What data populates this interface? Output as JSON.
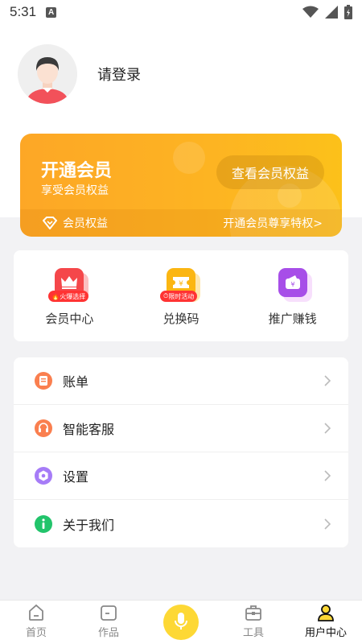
{
  "status": {
    "time": "5:31",
    "notif_letter": "A"
  },
  "profile": {
    "login_label": "请登录"
  },
  "vip": {
    "title": "开通会员",
    "subtitle": "享受会员权益",
    "button": "查看会员权益",
    "rights_label": "会员权益",
    "privilege_link": "开通会员尊享特权>"
  },
  "quick": [
    {
      "label": "会员中心",
      "badge": "火爆选择",
      "icon": "crown-icon",
      "color": "#f5474a"
    },
    {
      "label": "兑换码",
      "badge": "限时活动",
      "icon": "coupon-icon",
      "color": "#fbb612"
    },
    {
      "label": "推广赚钱",
      "badge": "",
      "icon": "wallet-icon",
      "color": "#a74ee8"
    }
  ],
  "menu": [
    {
      "label": "账单",
      "icon": "bill-icon",
      "color": "#fa7f4f"
    },
    {
      "label": "智能客服",
      "icon": "headset-icon",
      "color": "#fa7f4f"
    },
    {
      "label": "设置",
      "icon": "settings-icon",
      "color": "#a67cf7"
    },
    {
      "label": "关于我们",
      "icon": "info-icon",
      "color": "#22c46b"
    }
  ],
  "tabs": [
    {
      "label": "首页",
      "icon": "home-icon"
    },
    {
      "label": "作品",
      "icon": "folder-icon"
    },
    {
      "label": "",
      "icon": "mic-icon"
    },
    {
      "label": "工具",
      "icon": "toolbox-icon"
    },
    {
      "label": "用户中心",
      "icon": "user-icon",
      "active": true
    }
  ],
  "colors": {
    "accent": "#fdb422",
    "mic": "#fdd835"
  }
}
